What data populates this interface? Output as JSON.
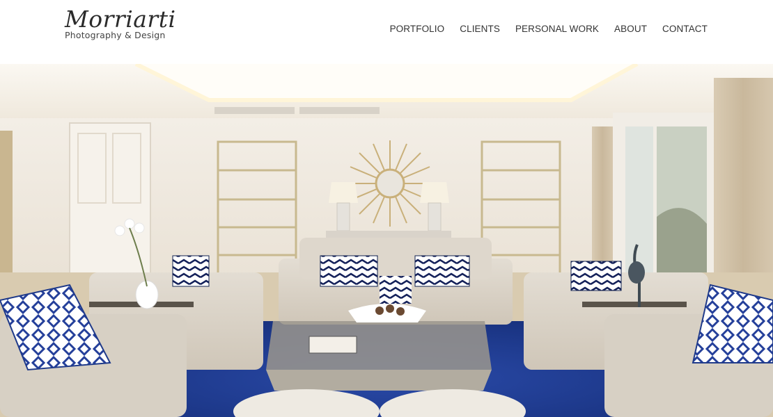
{
  "brand": {
    "name": "Morriarti",
    "tagline": "Photography & Design"
  },
  "nav": {
    "items": [
      {
        "label": "PORTFOLIO"
      },
      {
        "label": "CLIENTS"
      },
      {
        "label": "PERSONAL WORK"
      },
      {
        "label": "ABOUT"
      },
      {
        "label": "CONTACT"
      }
    ]
  },
  "colors": {
    "accent_navy": "#1f3a8a",
    "text": "#333333",
    "background": "#ffffff"
  }
}
